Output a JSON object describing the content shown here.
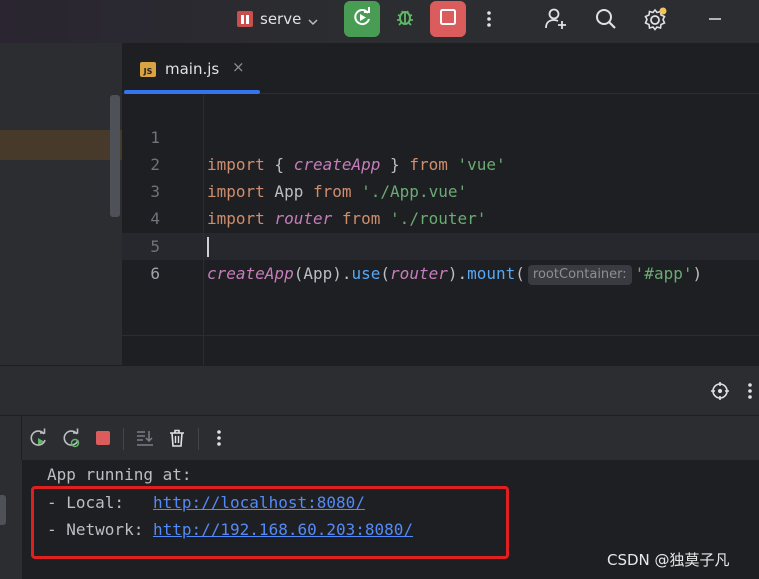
{
  "toolbar": {
    "run_config_name": "serve",
    "icons": [
      "run-config-icon",
      "chevron-down-icon",
      "rerun-icon",
      "debug-icon",
      "stop-icon",
      "more-vertical-icon",
      "add-user-icon",
      "search-icon",
      "settings-icon",
      "minimize-icon"
    ]
  },
  "editor": {
    "tab": {
      "name": "main.js",
      "badge": "JS",
      "close": "×"
    },
    "lines": [
      {
        "n": "1"
      },
      {
        "n": "2"
      },
      {
        "n": "3"
      },
      {
        "n": "4"
      },
      {
        "n": "5"
      },
      {
        "n": "6"
      }
    ],
    "code": {
      "l1": {
        "kw1": "import",
        "p1": " { ",
        "fn": "createApp",
        "p2": " } ",
        "kw2": "from",
        "sp": " ",
        "str": "'vue'"
      },
      "l2": {
        "kw1": "import",
        "p1": " App ",
        "kw2": "from",
        "sp": " ",
        "str": "'./App.vue'"
      },
      "l3": {
        "kw1": "import",
        "sp1": " ",
        "fn": "router",
        "sp2": " ",
        "kw2": "from",
        "sp3": " ",
        "str": "'./router'"
      },
      "l5": {
        "fn1": "createApp",
        "p1": "(App).",
        "m1": "use",
        "p2": "(",
        "fn2": "router",
        "p3": ").",
        "m2": "mount",
        "p4": "(",
        "hint": "rootContainer:",
        "str": "'#app'",
        "p5": ")"
      }
    }
  },
  "console": {
    "line1": "App running at:",
    "local_label": "- Local:   ",
    "local_url": "http://localhost:8080/",
    "network_label": "- Network: ",
    "network_url": "http://192.168.60.203:8080/"
  },
  "watermark": "CSDN @独莫子凡",
  "colors": {
    "accent": "#3574f0",
    "run_green": "#499c54",
    "stop_red": "#db5c5c",
    "highlight_box": "#e02020",
    "link": "#548af7"
  }
}
